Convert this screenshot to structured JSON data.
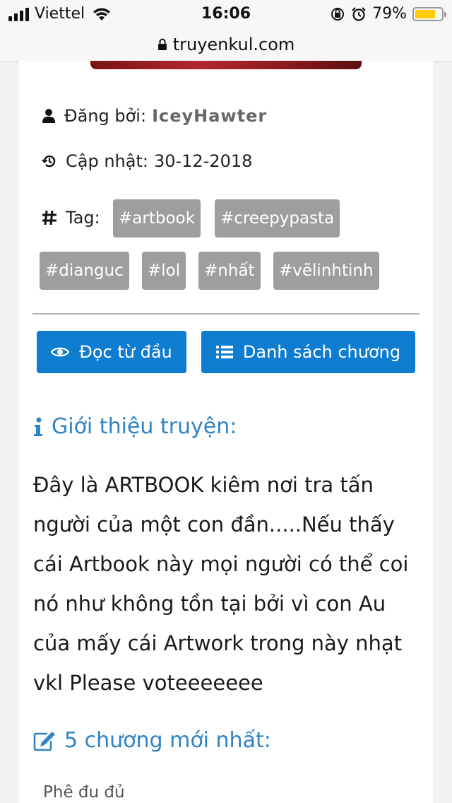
{
  "status_bar": {
    "carrier": "Viettel",
    "time": "16:06",
    "battery_percent": "79%",
    "battery_level": 0.79,
    "battery_color": "#ffcc00"
  },
  "browser": {
    "url": "truyenkul.com"
  },
  "story": {
    "posted_by_label": "Đăng bởi:",
    "posted_by_value": "IceyHawter",
    "updated_label": "Cập nhật:",
    "updated_value": "30-12-2018",
    "tag_label": "Tag:",
    "tags": [
      "#artbook",
      "#creepypasta",
      "#dianguc",
      "#lol",
      "#nhất",
      "#vẽlinhtinh"
    ],
    "read_from_start": "Đọc từ đầu",
    "chapter_list": "Danh sách chương",
    "intro_title": "Giới thiệu truyện:",
    "description": "Đây là ARTBOOK kiêm nơi tra tấn người của một con đần.....Nếu thấy cái Artbook này mọi người có thể coi nó như không tồn tại bởi vì con Au của mấy cái Artwork trong này nhạt vkl Please voteeeeeee",
    "latest_title": "5 chương mới nhất:",
    "latest_chapters": [
      "Phê đu đủ"
    ]
  },
  "colors": {
    "accent": "#0e7ccf",
    "section_title": "#2f84c6",
    "tag_bg": "#9e9e9e"
  }
}
